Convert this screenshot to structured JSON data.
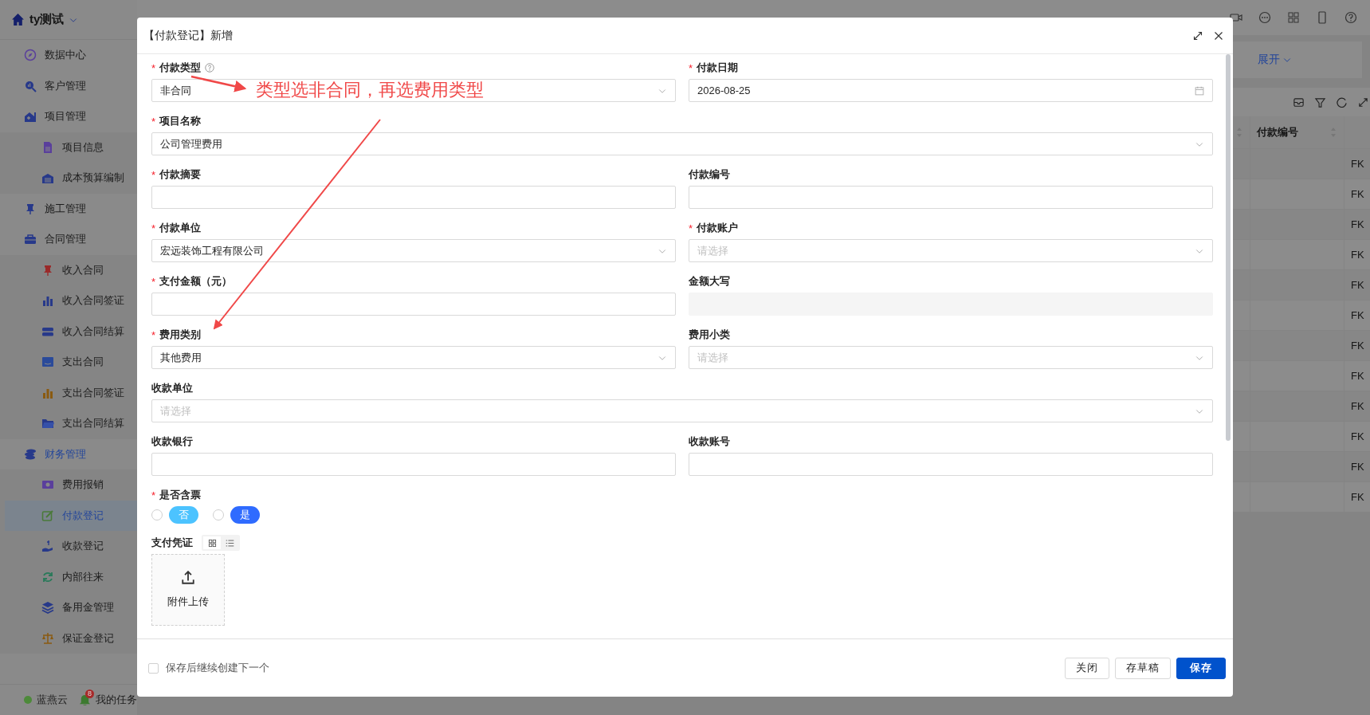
{
  "app": {
    "workspace": "ty测试"
  },
  "sidebar": {
    "items": [
      {
        "label": "数据中心",
        "selected": false
      },
      {
        "label": "客户管理",
        "selected": false
      },
      {
        "label": "项目管理",
        "selected": false,
        "expanded": true,
        "children": [
          {
            "label": "项目信息",
            "selected": false
          },
          {
            "label": "成本预算编制",
            "selected": false
          }
        ]
      },
      {
        "label": "施工管理",
        "selected": false
      },
      {
        "label": "合同管理",
        "selected": false,
        "expanded": true,
        "children": [
          {
            "label": "收入合同",
            "selected": false
          },
          {
            "label": "收入合同签证",
            "selected": false
          },
          {
            "label": "收入合同结算",
            "selected": false
          },
          {
            "label": "支出合同",
            "selected": false
          },
          {
            "label": "支出合同签证",
            "selected": false
          },
          {
            "label": "支出合同结算",
            "selected": false
          }
        ]
      },
      {
        "label": "财务管理",
        "selected": false,
        "expanded": true,
        "children": [
          {
            "label": "费用报销",
            "selected": false
          },
          {
            "label": "付款登记",
            "selected": true
          },
          {
            "label": "收款登记",
            "selected": false
          },
          {
            "label": "内部往来",
            "selected": false
          },
          {
            "label": "备用金管理",
            "selected": false
          },
          {
            "label": "保证金登记",
            "selected": false
          }
        ]
      }
    ]
  },
  "sidebar_footer": {
    "brand": "蓝燕云",
    "tasks_label": "我的任务",
    "tasks_badge": "8"
  },
  "filter_bar": {
    "expand_link": "展开"
  },
  "table": {
    "columns": [
      {
        "label": "付款编号",
        "sortable": true
      }
    ],
    "rows": [
      {
        "column_2": "FK"
      },
      {
        "column_2": "FK"
      },
      {
        "column_2": "FK"
      },
      {
        "column_2": "FK"
      },
      {
        "column_2": "FK"
      },
      {
        "column_2": "FK"
      },
      {
        "column_2": "FK"
      },
      {
        "column_2": "FK"
      },
      {
        "column_2": "FK"
      },
      {
        "column_2": "FK"
      },
      {
        "column_2": "FK"
      },
      {
        "column_2": "FK"
      }
    ]
  },
  "modal": {
    "title": "【付款登记】新增",
    "annotation": {
      "text": "类型选非合同，再选费用类型"
    },
    "rows": [
      {
        "fields": [
          {
            "label": "付款类型",
            "required": "*",
            "help": true,
            "kind": "select",
            "value": "非合同"
          },
          {
            "label": "付款日期",
            "required": "*",
            "help": false,
            "kind": "date",
            "value": "2026-08-25"
          }
        ]
      },
      {
        "fields": [
          {
            "label": "项目名称",
            "required": "*",
            "help": false,
            "kind": "select",
            "value": "公司管理费用"
          }
        ]
      },
      {
        "fields": [
          {
            "label": "付款摘要",
            "required": "*",
            "help": false,
            "kind": "text"
          },
          {
            "label": "付款编号",
            "help": false,
            "kind": "text"
          }
        ]
      },
      {
        "fields": [
          {
            "label": "付款单位",
            "required": "*",
            "help": false,
            "kind": "select",
            "value": "宏远装饰工程有限公司"
          },
          {
            "label": "付款账户",
            "required": "*",
            "help": false,
            "kind": "select",
            "placeholder": "请选择"
          }
        ]
      },
      {
        "fields": [
          {
            "label": "支付金额（元）",
            "required": "*",
            "help": false,
            "kind": "text"
          },
          {
            "label": "金额大写",
            "help": false,
            "kind": "readonly"
          }
        ]
      },
      {
        "fields": [
          {
            "label": "费用类别",
            "required": "*",
            "help": false,
            "kind": "select",
            "value": "其他费用"
          },
          {
            "label": "费用小类",
            "help": false,
            "kind": "select",
            "placeholder": "请选择"
          }
        ]
      },
      {
        "fields": [
          {
            "label": "收款单位",
            "help": false,
            "kind": "select",
            "placeholder": "请选择"
          }
        ]
      },
      {
        "fields": [
          {
            "label": "收款银行",
            "help": false,
            "kind": "text"
          },
          {
            "label": "收款账号",
            "help": false,
            "kind": "text"
          }
        ]
      },
      {
        "fields": [
          {
            "label": "是否含票",
            "required": "*",
            "help": false,
            "kind": "radio",
            "options": [
              {
                "label": "否",
                "selected": false,
                "color": "#4cc3ff"
              },
              {
                "label": "是",
                "selected": false,
                "color": "#2f6bff"
              }
            ]
          }
        ]
      },
      {
        "fields": [
          {
            "label": "支付凭证",
            "help": false,
            "kind": "upload",
            "views": [
              {
                "kind": "grid",
                "selected": true
              },
              {
                "kind": "list",
                "selected": false
              }
            ],
            "upload_label": "附件上传"
          }
        ]
      }
    ],
    "continue_checkbox": {
      "label": "保存后继续创建下一个",
      "checked": false
    },
    "buttons": [
      {
        "label": "关闭",
        "kind": "default"
      },
      {
        "label": "存草稿",
        "kind": "default"
      },
      {
        "label": "保存",
        "kind": "primary"
      }
    ]
  }
}
